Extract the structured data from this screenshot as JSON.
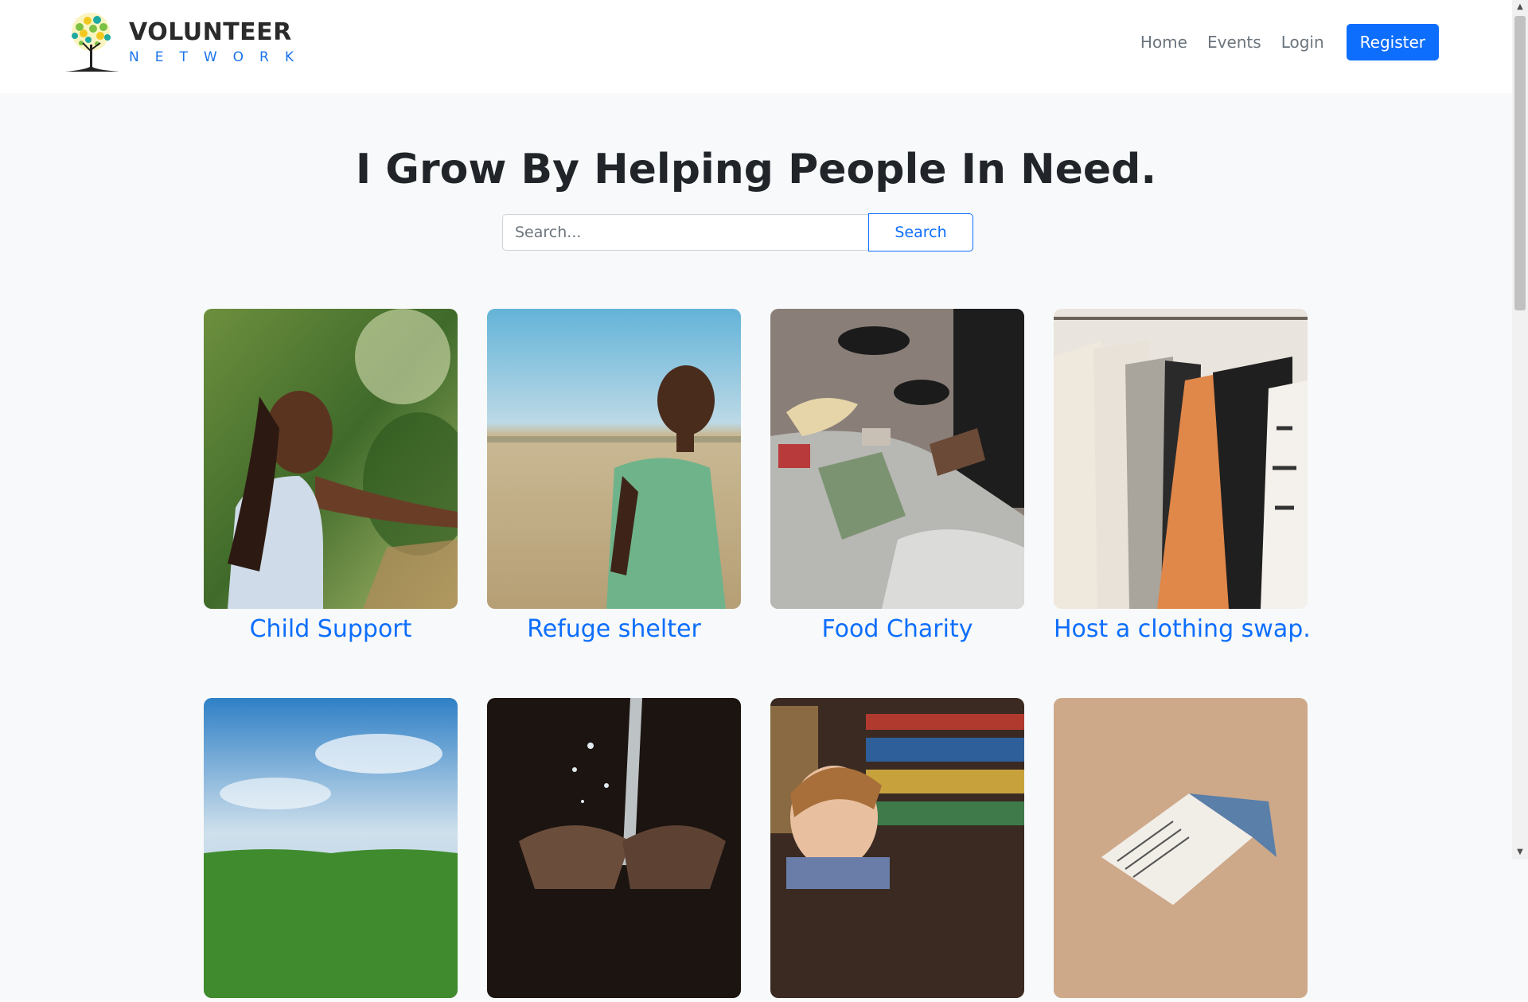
{
  "brand": {
    "line1": "VOLUNTEER",
    "line2": "NETWORK"
  },
  "nav": {
    "home": "Home",
    "events": "Events",
    "login": "Login",
    "register": "Register"
  },
  "hero": {
    "title": "I Grow By Helping People In Need."
  },
  "search": {
    "placeholder": "Search...",
    "button": "Search"
  },
  "cards": [
    {
      "title": "Child Support"
    },
    {
      "title": "Refuge shelter"
    },
    {
      "title": "Food Charity"
    },
    {
      "title": "Host a clothing swap."
    },
    {
      "title": ""
    },
    {
      "title": ""
    },
    {
      "title": ""
    },
    {
      "title": ""
    }
  ],
  "colors": {
    "primary": "#0d6efd",
    "background": "#f8f9fa",
    "heading": "#212529"
  }
}
